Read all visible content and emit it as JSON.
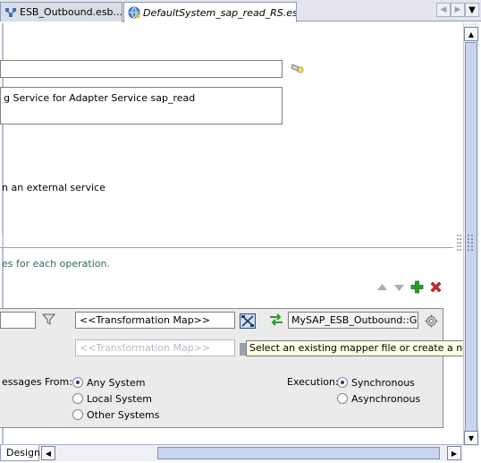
{
  "tabs": [
    {
      "label": "ESB_Outbound.esb..."
    },
    {
      "label": "DefaultSystem_sap_read_RS.esbsvc"
    }
  ],
  "form": {
    "description_text": "g Service for Adapter Service sap_read",
    "external_service_text": "n an external service",
    "operation_hint": "es for each operation."
  },
  "panel": {
    "transformation_map_value": "<<Transformation Map>>",
    "transformation_map_placeholder": "<<Transformation Map>>",
    "target_operation": "MySAP_ESB_Outbound::GetD",
    "messages_from_label": "essages From:",
    "system_options": [
      "Any System",
      "Local System",
      "Other Systems"
    ],
    "system_selected": "Any System",
    "execution_label": "Execution:",
    "execution_options": [
      "Synchronous",
      "Asynchronous"
    ],
    "execution_selected": "Synchronous"
  },
  "tooltip": "Select an existing mapper file or create a new one.",
  "bottom_tabs": {
    "design_label": "Design"
  },
  "colors": {
    "hint_text": "#2d6b54",
    "add_icon": "#2f9a2f",
    "delete_icon": "#d2282e",
    "tooltip_bg": "#ffffe1"
  },
  "icons": [
    "esb-diagram-icon",
    "service-globe-icon",
    "browse-flashlight-icon",
    "filter-funnel-icon",
    "mapper-icon",
    "swap-arrows-icon",
    "gear-icon",
    "move-up-icon",
    "move-down-icon",
    "add-icon",
    "delete-icon"
  ]
}
